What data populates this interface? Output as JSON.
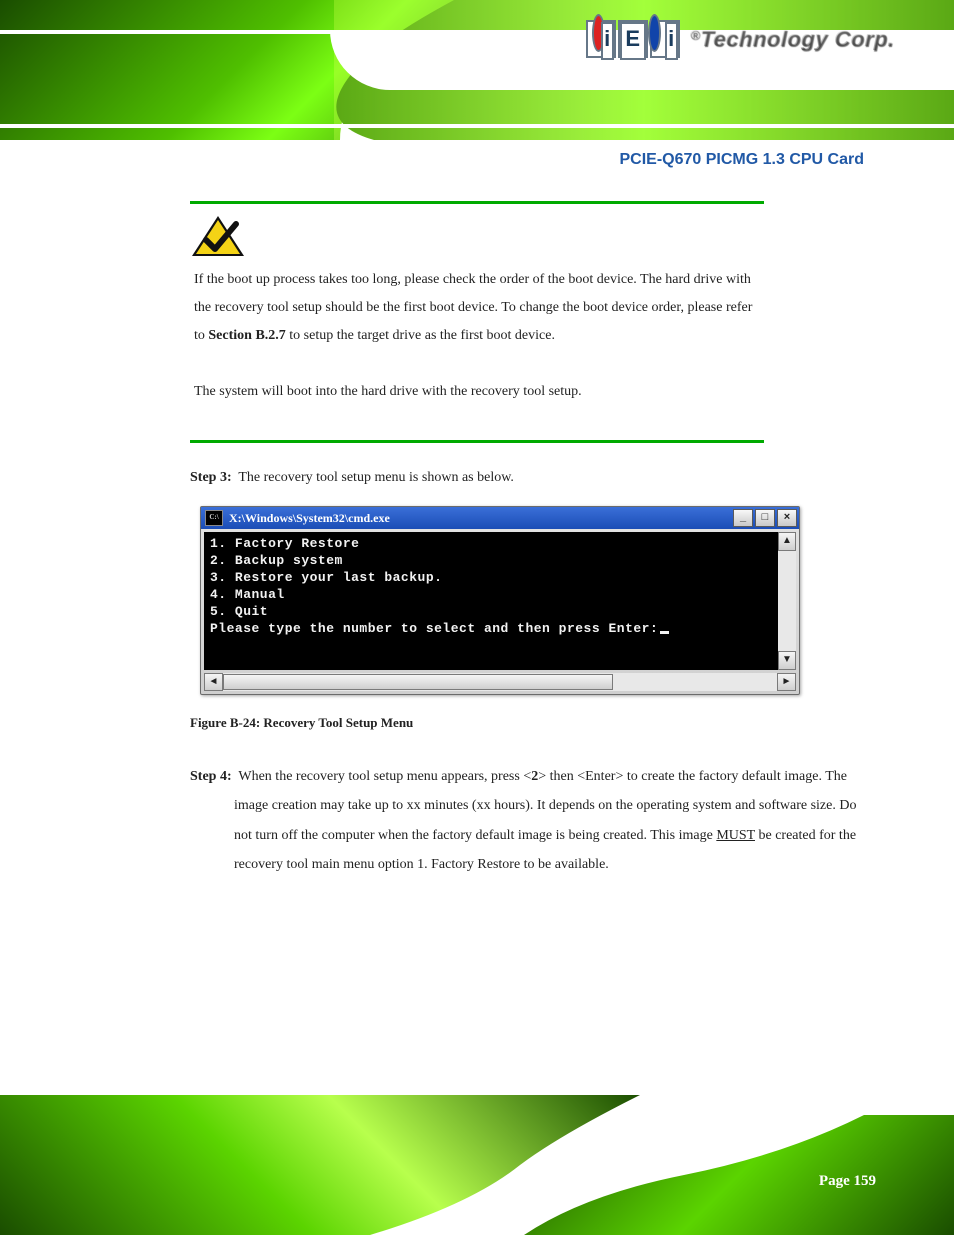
{
  "brand": {
    "mark_letters": [
      "i",
      "E",
      "i"
    ],
    "tagline_reg": "®",
    "tagline": "Technology Corp."
  },
  "doc": {
    "title": "PCIE-Q670 PICMG 1.3 CPU Card",
    "step3_label": "Step 3:",
    "step3_text": "The recovery tool setup menu is shown as below.",
    "note": {
      "p1_pre": "If the boot up process takes too long, please check the order of the boot device. The hard drive with the recovery tool setup should be the first boot device. To change the boot device order, please refer to ",
      "p1_ref_label": "Section",
      "p1_ref": "B.2.7",
      "p1_post": " to setup the target drive as the first boot device.",
      "p2": "The system will boot into the hard drive with the recovery tool setup."
    },
    "cmd": {
      "title": "X:\\Windows\\System32\\cmd.exe",
      "lines": [
        "1. Factory Restore",
        "2. Backup system",
        "3. Restore your last backup.",
        "4. Manual",
        "5. Quit",
        "Please type the number to select and then press Enter:"
      ]
    },
    "figure_caption": "Figure B-24: Recovery Tool Setup Menu",
    "step4_label": "Step 4:",
    "step4_pre": "When the recovery tool setup menu appears, press <",
    "step4_key": "2",
    "step4_mid": "> then <Enter> to create the factory default image. The image creation may take up to xx minutes (xx hours). It depends on the operating system and software size. Do not turn off the computer when the factory default image is being created. This image ",
    "step4_must": "MUST",
    "step4_post": " be created for the recovery tool main menu option 1. Factory Restore to be available."
  },
  "page_number": "Page 159"
}
